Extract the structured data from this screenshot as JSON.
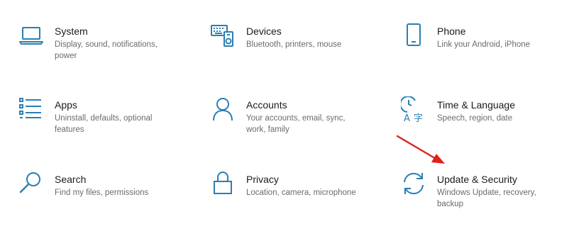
{
  "tiles": [
    {
      "id": "system",
      "title": "System",
      "desc": "Display, sound, notifications, power",
      "icon": "laptop-icon"
    },
    {
      "id": "devices",
      "title": "Devices",
      "desc": "Bluetooth, printers, mouse",
      "icon": "devices-icon"
    },
    {
      "id": "phone",
      "title": "Phone",
      "desc": "Link your Android, iPhone",
      "icon": "phone-icon"
    },
    {
      "id": "apps",
      "title": "Apps",
      "desc": "Uninstall, defaults, optional features",
      "icon": "apps-list-icon"
    },
    {
      "id": "accounts",
      "title": "Accounts",
      "desc": "Your accounts, email, sync, work, family",
      "icon": "person-icon"
    },
    {
      "id": "time-language",
      "title": "Time & Language",
      "desc": "Speech, region, date",
      "icon": "time-language-icon"
    },
    {
      "id": "search",
      "title": "Search",
      "desc": "Find my files, permissions",
      "icon": "search-icon"
    },
    {
      "id": "privacy",
      "title": "Privacy",
      "desc": "Location, camera, microphone",
      "icon": "lock-icon"
    },
    {
      "id": "update-security",
      "title": "Update & Security",
      "desc": "Windows Update, recovery, backup",
      "icon": "refresh-icon"
    }
  ],
  "colors": {
    "icon": "#2a7fb3",
    "title": "#1b1b1b",
    "desc": "#6b6b6b",
    "arrow": "#e0201b"
  }
}
